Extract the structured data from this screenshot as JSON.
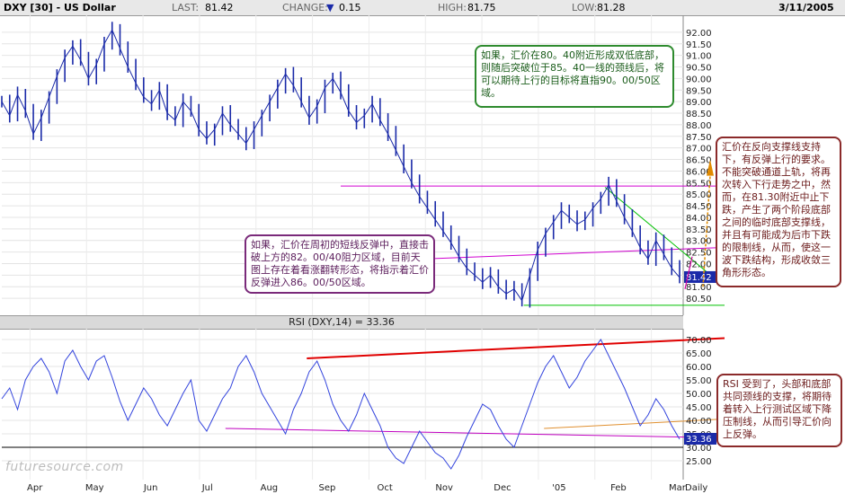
{
  "header": {
    "symbol": "DXY [30] - US Dollar",
    "last_label": "LAST:",
    "last_value": "81.42",
    "change_label": "CHANGE:",
    "change_arrow": "▼",
    "change_value": "0.15",
    "high_label": "HIGH:",
    "high_value": "81.75",
    "low_label": "LOW:",
    "low_value": "81.28",
    "date": "3/11/2005"
  },
  "chart_data": [
    {
      "type": "line",
      "title": "DXY [30] - US Dollar",
      "ylim": [
        80.0,
        92.5
      ],
      "y_ticks": [
        "92.00",
        "91.50",
        "91.00",
        "90.50",
        "90.00",
        "89.50",
        "89.00",
        "88.50",
        "88.00",
        "87.50",
        "87.00",
        "86.50",
        "86.00",
        "85.50",
        "85.00",
        "84.50",
        "84.00",
        "83.50",
        "83.00",
        "82.50",
        "82.00",
        "81.50",
        "81.00",
        "80.50"
      ],
      "x_labels": [
        "Apr",
        "May",
        "Jun",
        "Jul",
        "Aug",
        "Sep",
        "Oct",
        "Nov",
        "Dec",
        "'05",
        "Feb",
        "Mar",
        "Daily"
      ],
      "last_price_label": "81.42",
      "series": [
        {
          "values": [
            89.0,
            88.4,
            89.3,
            88.6,
            87.6,
            88.3,
            89.2,
            90.1,
            90.9,
            91.4,
            90.8,
            90.0,
            90.6,
            91.5,
            92.1,
            91.3,
            90.5,
            89.8,
            89.2,
            88.9,
            89.5,
            88.5,
            88.2,
            89.0,
            88.6,
            87.8,
            87.4,
            87.8,
            88.5,
            88.0,
            87.6,
            87.2,
            87.8,
            88.4,
            89.0,
            89.6,
            90.2,
            89.7,
            89.0,
            88.3,
            88.8,
            89.6,
            90.0,
            89.4,
            88.6,
            88.1,
            88.4,
            88.9,
            88.2,
            87.6,
            86.9,
            86.2,
            85.5,
            84.9,
            84.4,
            83.9,
            83.4,
            82.9,
            82.3,
            81.8,
            81.5,
            81.2,
            81.5,
            81.0,
            80.7,
            80.9,
            80.4,
            81.5,
            82.6,
            83.3,
            83.8,
            84.3,
            84.0,
            83.7,
            83.9,
            84.4,
            84.8,
            85.4,
            84.7,
            84.0,
            83.4,
            82.7,
            82.2,
            83.0,
            82.4,
            81.8,
            81.4
          ]
        }
      ],
      "trendlines": [
        {
          "color": "#d000d0",
          "points": [
            [
              0.5,
              85.35
            ],
            [
              1.0,
              85.35
            ]
          ]
        },
        {
          "color": "#d000d0",
          "points": [
            [
              0.62,
              82.2
            ],
            [
              1.0,
              82.7
            ]
          ]
        },
        {
          "color": "#00c000",
          "points": [
            [
              0.77,
              80.2
            ],
            [
              1.0,
              80.2
            ]
          ]
        },
        {
          "color": "#00c000",
          "points": [
            [
              0.89,
              85.3
            ],
            [
              1.0,
              81.0
            ]
          ]
        }
      ]
    },
    {
      "type": "line",
      "title": "RSI (DXY,14) = 33.36",
      "ylim": [
        20,
        72
      ],
      "y_ticks": [
        "70.00",
        "65.00",
        "60.00",
        "55.00",
        "50.00",
        "45.00",
        "40.00",
        "35.00",
        "30.00",
        "25.00"
      ],
      "last_value_label": "33.36",
      "series": [
        {
          "values": [
            48,
            52,
            44,
            55,
            60,
            63,
            58,
            50,
            62,
            66,
            60,
            55,
            62,
            64,
            56,
            47,
            40,
            46,
            52,
            48,
            42,
            38,
            44,
            50,
            55,
            40,
            36,
            42,
            48,
            52,
            60,
            64,
            58,
            50,
            45,
            40,
            35,
            44,
            50,
            58,
            62,
            55,
            46,
            40,
            36,
            42,
            50,
            44,
            38,
            30,
            26,
            24,
            30,
            36,
            32,
            28,
            26,
            22,
            27,
            34,
            40,
            46,
            44,
            38,
            33,
            30,
            38,
            46,
            54,
            60,
            64,
            58,
            52,
            56,
            62,
            66,
            70,
            64,
            58,
            52,
            45,
            38,
            42,
            48,
            44,
            38,
            33
          ]
        }
      ],
      "reference_lines": [
        {
          "color": "#000000",
          "value": 30
        }
      ],
      "trendlines": [
        {
          "color": "#e00000",
          "points": [
            [
              0.45,
              63
            ],
            [
              1.0,
              70.5
            ]
          ]
        },
        {
          "color": "#c000c0",
          "points": [
            [
              0.33,
              37
            ],
            [
              1.0,
              33.5
            ]
          ]
        },
        {
          "color": "#e09030",
          "points": [
            [
              0.8,
              37
            ],
            [
              1.0,
              40.5
            ]
          ]
        }
      ]
    }
  ],
  "annotations": {
    "green": "如果，汇价在80。40附近形成双低底部，则随后突破位于85。40一线的颈线后，将可以期待上行的目标将直指90。00/50区域。",
    "purple": "如果，汇价在周初的短线反弹中，直接击破上方的82。00/40阻力区域，目前天图上存在着看涨翻转形态，将指示着汇价反弹进入86。00/50区域。",
    "brown1": "汇价在反向支撑线支持下，有反弹上行的要求。不能突破通道上轨，将再次转入下行走势之中，然而，在81.30附近中止下跌，产生了两个阶段底部之间的临时底部支撑线，并且有可能成为后市下跌的限制线，从而，使这一波下跌结构，形成收敛三角形形态。",
    "brown2": "RSI 受到了，头部和底部共同颈线的支撑，将期待着转入上行测试区域下降压制线，从而引导汇价向上反弹。"
  },
  "watermark": "futuresource.com",
  "colors": {
    "price_bar": "#1a2aa8",
    "rsi_line": "#3344dd",
    "down_arrow": "#1a2aa8"
  }
}
